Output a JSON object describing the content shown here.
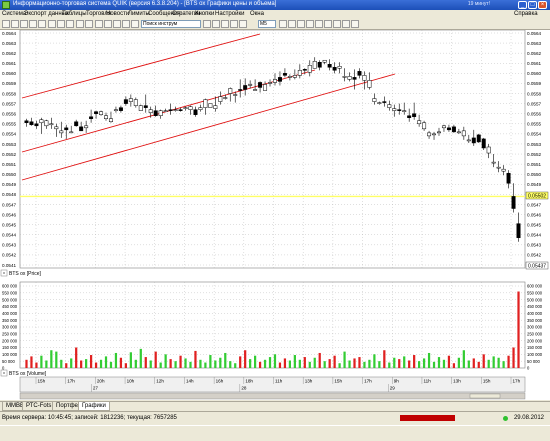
{
  "app": {
    "title": "Информационно-торговая система QUIK (версия 6.3.8.204) - [BTS ох Графики цены и объема]",
    "meta": "19 минут!"
  },
  "menu": [
    "Система",
    "Экспорт данных",
    "Таблицы",
    "Торговля",
    "Новости",
    "Лимиты",
    "Сообщения",
    "Стратегии",
    "Кнопки",
    "Настройки",
    "Окна",
    "Справка"
  ],
  "toolbar": {
    "search_placeholder": "Поиск инструм",
    "interval": "M5"
  },
  "chart": {
    "price_legend": "BTS ох [Price]",
    "volume_legend": "BTS ох [Volume]",
    "last_price_label": "0.05502",
    "current_price_label": "0.05437",
    "colors": {
      "up": "#ffffff",
      "down": "#000000",
      "trend": "#e01010",
      "hline": "#ffff80",
      "vol_up": "#33cc33",
      "vol_down": "#e02020"
    }
  },
  "chart_data": {
    "type": "candlestick",
    "price_axis": {
      "ylim": [
        0.0541,
        0.0564
      ],
      "ticks": [
        "0.0541",
        "0.0542",
        "0.0543",
        "0.0544",
        "0.0545",
        "0.0546",
        "0.0547",
        "0.0548",
        "0.0549",
        "0.0550",
        "0.0551",
        "0.0552",
        "0.0553",
        "0.0554",
        "0.0555",
        "0.0556",
        "0.0557",
        "0.0558",
        "0.0559",
        "0.0560",
        "0.0561",
        "0.0562",
        "0.0563",
        "0.0564"
      ]
    },
    "volume_axis": {
      "ylim": [
        0,
        600000
      ],
      "ticks": [
        "0",
        "50 000",
        "100 000",
        "150 000",
        "200 000",
        "250 000",
        "300 000",
        "350 000",
        "400 000",
        "450 000",
        "500 000",
        "550 000",
        "600 000"
      ]
    },
    "time_ticks": [
      "15h",
      "17h",
      "20h",
      "10h",
      "12h",
      "14h",
      "16h",
      "18h",
      "11h",
      "13h",
      "15h",
      "17h",
      "9h",
      "11h",
      "13h",
      "15h",
      "17h"
    ],
    "date_ticks": [
      "27",
      "28",
      "29"
    ],
    "candles": [
      [
        0.05553,
        0.05555,
        0.05547,
        0.05551
      ],
      [
        0.05552,
        0.05556,
        0.05548,
        0.05549
      ],
      [
        0.0555,
        0.05553,
        0.05545,
        0.05548
      ],
      [
        0.05551,
        0.05556,
        0.0554,
        0.05554
      ],
      [
        0.05548,
        0.05554,
        0.05545,
        0.05553
      ],
      [
        0.05549,
        0.05556,
        0.05545,
        0.0555
      ],
      [
        0.05545,
        0.0555,
        0.05537,
        0.05547
      ],
      [
        0.05541,
        0.05552,
        0.05536,
        0.05543
      ],
      [
        0.05546,
        0.05549,
        0.05535,
        0.05544
      ],
      [
        0.05542,
        0.05548,
        0.05541,
        0.05542
      ],
      [
        0.05552,
        0.05554,
        0.05547,
        0.05548
      ],
      [
        0.05547,
        0.05552,
        0.05543,
        0.05543
      ],
      [
        0.05546,
        0.05553,
        0.05541,
        0.05548
      ],
      [
        0.05557,
        0.05564,
        0.05551,
        0.05555
      ],
      [
        0.05562,
        0.05563,
        0.05555,
        0.0556
      ],
      [
        0.05559,
        0.05563,
        0.05558,
        0.05562
      ],
      [
        0.05555,
        0.05561,
        0.05553,
        0.05558
      ],
      [
        0.05552,
        0.05562,
        0.05551,
        0.05555
      ],
      [
        0.05564,
        0.05567,
        0.05561,
        0.05564
      ],
      [
        0.05566,
        0.05568,
        0.05561,
        0.05563
      ],
      [
        0.05574,
        0.05577,
        0.05568,
        0.0557
      ],
      [
        0.05572,
        0.05579,
        0.05567,
        0.05575
      ],
      [
        0.05568,
        0.05576,
        0.05566,
        0.05574
      ],
      [
        0.05563,
        0.05569,
        0.05563,
        0.05568
      ],
      [
        0.05568,
        0.05579,
        0.05561,
        0.05566
      ],
      [
        0.05561,
        0.05567,
        0.05556,
        0.05564
      ],
      [
        0.05563,
        0.05568,
        0.05557,
        0.05558
      ],
      [
        0.05558,
        0.05564,
        0.05555,
        0.05563
      ],
      [
        0.05563,
        0.05565,
        0.05562,
        0.05563
      ],
      [
        0.05564,
        0.0557,
        0.05559,
        0.05563
      ],
      [
        0.05564,
        0.05567,
        0.05562,
        0.05564
      ],
      [
        0.05564,
        0.05566,
        0.05562,
        0.05563
      ],
      [
        0.05565,
        0.05567,
        0.05563,
        0.05566
      ],
      [
        0.05564,
        0.05568,
        0.05559,
        0.05567
      ],
      [
        0.05564,
        0.05567,
        0.05557,
        0.05559
      ],
      [
        0.05564,
        0.05569,
        0.05562,
        0.05566
      ],
      [
        0.05566,
        0.05575,
        0.05559,
        0.05574
      ],
      [
        0.05566,
        0.0557,
        0.05566,
        0.0557
      ],
      [
        0.05565,
        0.05577,
        0.05562,
        0.05568
      ],
      [
        0.05572,
        0.05582,
        0.05569,
        0.05577
      ],
      [
        0.05576,
        0.05579,
        0.05574,
        0.05576
      ],
      [
        0.0558,
        0.05586,
        0.05572,
        0.05585
      ],
      [
        0.05579,
        0.05582,
        0.05571,
        0.05579
      ],
      [
        0.05584,
        0.05594,
        0.05576,
        0.05583
      ],
      [
        0.05588,
        0.05595,
        0.05578,
        0.05584
      ],
      [
        0.05588,
        0.05593,
        0.05585,
        0.05589
      ],
      [
        0.05584,
        0.05594,
        0.05583,
        0.05584
      ],
      [
        0.05591,
        0.05592,
        0.05581,
        0.05586
      ],
      [
        0.05583,
        0.05592,
        0.05583,
        0.05589
      ],
      [
        0.05591,
        0.05594,
        0.05587,
        0.05591
      ],
      [
        0.05591,
        0.056,
        0.05588,
        0.05594
      ],
      [
        0.05596,
        0.05602,
        0.05588,
        0.05592
      ],
      [
        0.056,
        0.05605,
        0.05596,
        0.05598
      ],
      [
        0.05596,
        0.05599,
        0.05593,
        0.05597
      ],
      [
        0.05596,
        0.05604,
        0.05594,
        0.05598
      ],
      [
        0.05598,
        0.05609,
        0.05595,
        0.05603
      ],
      [
        0.05604,
        0.05605,
        0.05599,
        0.05603
      ],
      [
        0.05601,
        0.05613,
        0.05597,
        0.05608
      ],
      [
        0.05605,
        0.05616,
        0.05605,
        0.05612
      ],
      [
        0.05611,
        0.05613,
        0.05603,
        0.05606
      ],
      [
        0.05611,
        0.05613,
        0.05609,
        0.05613
      ],
      [
        0.05609,
        0.05614,
        0.05603,
        0.05606
      ],
      [
        0.05606,
        0.05611,
        0.056,
        0.05603
      ],
      [
        0.05605,
        0.05611,
        0.056,
        0.05607
      ],
      [
        0.05596,
        0.05605,
        0.05592,
        0.05597
      ],
      [
        0.05594,
        0.05601,
        0.05592,
        0.05597
      ],
      [
        0.05596,
        0.05604,
        0.05584,
        0.05594
      ],
      [
        0.05602,
        0.05605,
        0.05595,
        0.05598
      ],
      [
        0.05593,
        0.05602,
        0.05584,
        0.05598
      ],
      [
        0.05586,
        0.05601,
        0.05584,
        0.05593
      ],
      [
        0.05572,
        0.0558,
        0.05569,
        0.05575
      ],
      [
        0.0557,
        0.05572,
        0.05569,
        0.05571
      ],
      [
        0.05572,
        0.05577,
        0.05567,
        0.05571
      ],
      [
        0.05566,
        0.05573,
        0.05563,
        0.05569
      ],
      [
        0.05563,
        0.05569,
        0.05557,
        0.05565
      ],
      [
        0.05564,
        0.0557,
        0.05559,
        0.05563
      ],
      [
        0.05562,
        0.05571,
        0.05559,
        0.05563
      ],
      [
        0.05558,
        0.05565,
        0.05552,
        0.05556
      ],
      [
        0.0556,
        0.05571,
        0.05554,
        0.05557
      ],
      [
        0.0555,
        0.05559,
        0.05547,
        0.05553
      ],
      [
        0.05545,
        0.05553,
        0.05543,
        0.05551
      ],
      [
        0.05538,
        0.05543,
        0.05535,
        0.05541
      ],
      [
        0.05539,
        0.05542,
        0.05534,
        0.0554
      ],
      [
        0.05542,
        0.05546,
        0.05538,
        0.05542
      ],
      [
        0.05546,
        0.05549,
        0.05542,
        0.05548
      ],
      [
        0.05546,
        0.05549,
        0.05542,
        0.05544
      ],
      [
        0.05547,
        0.05549,
        0.05541,
        0.05542
      ],
      [
        0.05542,
        0.05545,
        0.0554,
        0.05542
      ],
      [
        0.05538,
        0.05547,
        0.05534,
        0.05543
      ],
      [
        0.05534,
        0.05539,
        0.05531,
        0.05534
      ],
      [
        0.05536,
        0.05544,
        0.05528,
        0.05531
      ],
      [
        0.05539,
        0.0554,
        0.05531,
        0.05532
      ],
      [
        0.05535,
        0.05536,
        0.05524,
        0.05526
      ],
      [
        0.05521,
        0.0553,
        0.05516,
        0.05527
      ],
      [
        0.05512,
        0.0552,
        0.05507,
        0.05512
      ],
      [
        0.05507,
        0.05513,
        0.05502,
        0.05507
      ],
      [
        0.05503,
        0.05509,
        0.05499,
        0.05505
      ],
      [
        0.05501,
        0.05504,
        0.05486,
        0.05491
      ],
      [
        0.05478,
        0.05491,
        0.05462,
        0.05466
      ],
      [
        0.05451,
        0.05462,
        0.05433,
        0.05437
      ]
    ],
    "volumes": [
      60000,
      85000,
      40000,
      90000,
      55000,
      130000,
      120000,
      60000,
      35000,
      70000,
      150000,
      55000,
      65000,
      95000,
      40000,
      60000,
      85000,
      45000,
      110000,
      75000,
      35000,
      115000,
      60000,
      140000,
      80000,
      55000,
      120000,
      40000,
      100000,
      65000,
      50000,
      90000,
      70000,
      45000,
      125000,
      60000,
      40000,
      95000,
      55000,
      75000,
      110000,
      50000,
      35000,
      85000,
      130000,
      65000,
      90000,
      45000,
      60000,
      80000,
      100000,
      40000,
      70000,
      55000,
      95000,
      60000,
      80000,
      45000,
      75000,
      110000,
      50000,
      65000,
      90000,
      35000,
      120000,
      55000,
      70000,
      80000,
      45000,
      60000,
      100000,
      50000,
      130000,
      40000,
      75000,
      65000,
      85000,
      55000,
      95000,
      50000,
      70000,
      110000,
      45000,
      80000,
      60000,
      90000,
      35000,
      75000,
      130000,
      55000,
      70000,
      45000,
      100000,
      60000,
      85000,
      75000,
      50000,
      90000,
      150000,
      560000
    ]
  },
  "tabs": [
    "ММВБ",
    "РТС-Fots",
    "Портфель",
    "Графики"
  ],
  "status": {
    "text": "Время сервера: 10:45:45; записей: 1812236; текущая: 7657285",
    "date": "29.08.2012"
  }
}
